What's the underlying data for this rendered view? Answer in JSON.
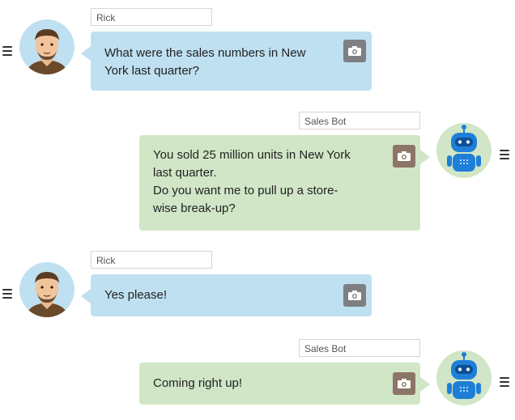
{
  "colors": {
    "user_bubble": "#bfe0f0",
    "bot_bubble": "#d0e6c6",
    "user_avatar_bg": "#bfe0f0",
    "bot_avatar_bg": "#d0e6c6",
    "bot_robot": "#1f7fd8"
  },
  "icons": {
    "menu": "hamburger-icon",
    "camera": "camera-icon",
    "user_avatar": "man-avatar",
    "bot_avatar": "robot-avatar"
  },
  "messages": [
    {
      "sender": "Rick",
      "role": "user",
      "text": "What were the sales numbers in New York last quarter?"
    },
    {
      "sender": "Sales Bot",
      "role": "bot",
      "text": "You sold 25 million units in New York last quarter.\nDo you want me to pull up a store-wise break-up?"
    },
    {
      "sender": "Rick",
      "role": "user",
      "text": "Yes please!"
    },
    {
      "sender": "Sales Bot",
      "role": "bot",
      "text": "Coming right up!"
    }
  ]
}
